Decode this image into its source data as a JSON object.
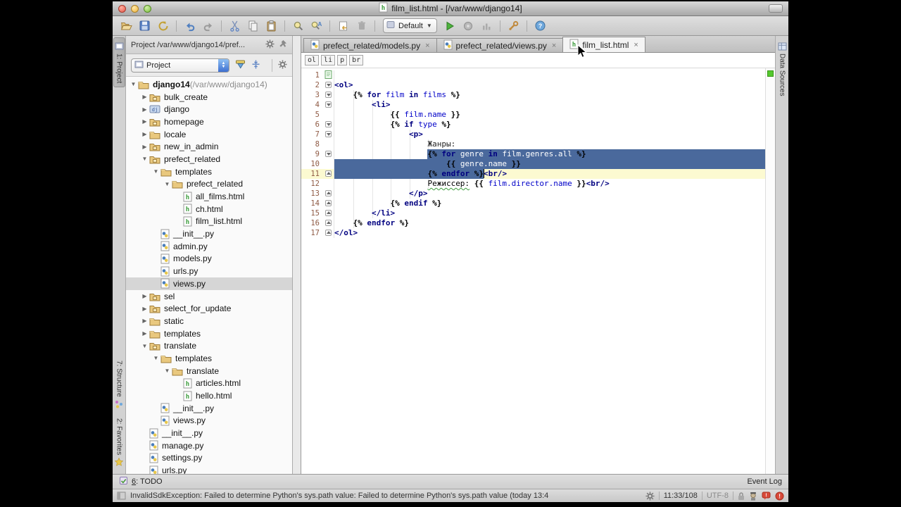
{
  "window": {
    "title": "film_list.html - [/var/www/django14]"
  },
  "toolbar": {
    "run_config": "Default",
    "buttons": [
      "open",
      "save",
      "sync",
      "|",
      "undo",
      "redo",
      "|",
      "cut",
      "copy",
      "paste",
      "|",
      "find",
      "replace",
      "|",
      "commit",
      "trash",
      "|",
      "combo",
      "run",
      "pkg",
      "cov",
      "|",
      "wrench",
      "|",
      "help"
    ]
  },
  "tabs": [
    {
      "label": "prefect_related/models.py",
      "icon": "py",
      "active": false
    },
    {
      "label": "prefect_related/views.py",
      "icon": "py",
      "active": false
    },
    {
      "label": "film_list.html",
      "icon": "html",
      "active": true
    }
  ],
  "tab_close_glyph": "×",
  "breadcrumbs": [
    "ol",
    "li",
    "p",
    "br"
  ],
  "left_stripe": {
    "project": "1: Project",
    "structure": "7: Structure",
    "favorites": "2: Favorites"
  },
  "right_stripe": {
    "data_sources": "Data Sources"
  },
  "project_panel": {
    "header": "Project /var/www/django14/pref...",
    "view_selector": "Project",
    "tree": [
      {
        "lv": 0,
        "icon": "folder",
        "arrow": "open",
        "label": "django14",
        "suffix": " (/var/www/django14)",
        "bold": true
      },
      {
        "lv": 1,
        "icon": "package",
        "arrow": "closed",
        "label": "bulk_create"
      },
      {
        "lv": 1,
        "icon": "django",
        "arrow": "closed",
        "label": "django"
      },
      {
        "lv": 1,
        "icon": "package",
        "arrow": "closed",
        "label": "homepage"
      },
      {
        "lv": 1,
        "icon": "folder",
        "arrow": "closed",
        "label": "locale"
      },
      {
        "lv": 1,
        "icon": "package",
        "arrow": "closed",
        "label": "new_in_admin"
      },
      {
        "lv": 1,
        "icon": "package",
        "arrow": "open",
        "label": "prefect_related"
      },
      {
        "lv": 2,
        "icon": "folder",
        "arrow": "open",
        "label": "templates"
      },
      {
        "lv": 3,
        "icon": "folder",
        "arrow": "open",
        "label": "prefect_related"
      },
      {
        "lv": 4,
        "icon": "html",
        "arrow": "",
        "label": "all_films.html"
      },
      {
        "lv": 4,
        "icon": "html",
        "arrow": "",
        "label": "ch.html"
      },
      {
        "lv": 4,
        "icon": "html",
        "arrow": "",
        "label": "film_list.html"
      },
      {
        "lv": 2,
        "icon": "py",
        "arrow": "",
        "label": "__init__.py"
      },
      {
        "lv": 2,
        "icon": "py",
        "arrow": "",
        "label": "admin.py"
      },
      {
        "lv": 2,
        "icon": "py",
        "arrow": "",
        "label": "models.py"
      },
      {
        "lv": 2,
        "icon": "py",
        "arrow": "",
        "label": "urls.py"
      },
      {
        "lv": 2,
        "icon": "py",
        "arrow": "",
        "label": "views.py",
        "sel": true
      },
      {
        "lv": 1,
        "icon": "package",
        "arrow": "closed",
        "label": "sel"
      },
      {
        "lv": 1,
        "icon": "package",
        "arrow": "closed",
        "label": "select_for_update"
      },
      {
        "lv": 1,
        "icon": "folder",
        "arrow": "closed",
        "label": "static"
      },
      {
        "lv": 1,
        "icon": "folder",
        "arrow": "closed",
        "label": "templates"
      },
      {
        "lv": 1,
        "icon": "package",
        "arrow": "open",
        "label": "translate"
      },
      {
        "lv": 2,
        "icon": "folder",
        "arrow": "open",
        "label": "templates"
      },
      {
        "lv": 3,
        "icon": "folder",
        "arrow": "open",
        "label": "translate"
      },
      {
        "lv": 4,
        "icon": "html",
        "arrow": "",
        "label": "articles.html"
      },
      {
        "lv": 4,
        "icon": "html",
        "arrow": "",
        "label": "hello.html"
      },
      {
        "lv": 2,
        "icon": "py",
        "arrow": "",
        "label": "__init__.py"
      },
      {
        "lv": 2,
        "icon": "py",
        "arrow": "",
        "label": "views.py"
      },
      {
        "lv": 1,
        "icon": "py",
        "arrow": "",
        "label": "__init__.py"
      },
      {
        "lv": 1,
        "icon": "py",
        "arrow": "",
        "label": "manage.py"
      },
      {
        "lv": 1,
        "icon": "py",
        "arrow": "",
        "label": "settings.py"
      },
      {
        "lv": 1,
        "icon": "py",
        "arrow": "",
        "label": "urls.py"
      }
    ]
  },
  "editor": {
    "lines": [
      {
        "n": 1,
        "icon": "file",
        "segs": []
      },
      {
        "n": 2,
        "fold": "open",
        "segs": [
          [
            "t",
            "<ol>"
          ]
        ]
      },
      {
        "n": 3,
        "fold": "open",
        "segs": [
          [
            "x",
            "    "
          ],
          [
            "b",
            "{%"
          ],
          [
            "x",
            " "
          ],
          [
            "k",
            "for"
          ],
          [
            "x",
            " "
          ],
          [
            "v",
            "film"
          ],
          [
            "x",
            " "
          ],
          [
            "k",
            "in"
          ],
          [
            "x",
            " "
          ],
          [
            "v",
            "films"
          ],
          [
            "x",
            " "
          ],
          [
            "b",
            "%}"
          ]
        ]
      },
      {
        "n": 4,
        "fold": "open",
        "segs": [
          [
            "x",
            "        "
          ],
          [
            "t",
            "<li>"
          ]
        ]
      },
      {
        "n": 5,
        "segs": [
          [
            "x",
            "            "
          ],
          [
            "b",
            "{{"
          ],
          [
            "x",
            " "
          ],
          [
            "v",
            "film.name"
          ],
          [
            "x",
            " "
          ],
          [
            "b",
            "}}"
          ]
        ]
      },
      {
        "n": 6,
        "fold": "open",
        "segs": [
          [
            "x",
            "            "
          ],
          [
            "b",
            "{%"
          ],
          [
            "x",
            " "
          ],
          [
            "k",
            "if"
          ],
          [
            "x",
            " "
          ],
          [
            "v",
            "type"
          ],
          [
            "x",
            " "
          ],
          [
            "b",
            "%}"
          ]
        ]
      },
      {
        "n": 7,
        "fold": "open",
        "segs": [
          [
            "x",
            "                "
          ],
          [
            "t",
            "<p>"
          ]
        ]
      },
      {
        "n": 8,
        "segs": [
          [
            "x",
            "                    "
          ],
          [
            "x",
            "Жанры:"
          ]
        ]
      },
      {
        "n": 9,
        "fold": "open",
        "onsel": true,
        "sel": {
          "start": 20
        },
        "segs": [
          [
            "x",
            "                    "
          ],
          [
            "b",
            "{%"
          ],
          [
            "x",
            " "
          ],
          [
            "k",
            "for"
          ],
          [
            "x",
            " "
          ],
          [
            "v",
            "genre"
          ],
          [
            "x",
            " "
          ],
          [
            "k",
            "in"
          ],
          [
            "x",
            " "
          ],
          [
            "v",
            "film.genres.all"
          ],
          [
            "x",
            " "
          ],
          [
            "b",
            "%}"
          ]
        ]
      },
      {
        "n": 10,
        "onsel": true,
        "sel": {
          "start": 0
        },
        "segs": [
          [
            "x",
            "                        "
          ],
          [
            "b",
            "{{"
          ],
          [
            "x",
            " "
          ],
          [
            "v",
            "genre.name"
          ],
          [
            "x",
            " "
          ],
          [
            "b",
            "}}"
          ]
        ]
      },
      {
        "n": 11,
        "fold": "close",
        "cur": true,
        "caret": 32,
        "sel": {
          "start": 0,
          "width": 32
        },
        "segs": [
          [
            "x",
            "                    "
          ],
          [
            "b",
            "{%"
          ],
          [
            "x",
            " "
          ],
          [
            "k",
            "endfor"
          ],
          [
            "x",
            " "
          ],
          [
            "b",
            "%}"
          ],
          [
            "t",
            "<br/>"
          ]
        ]
      },
      {
        "n": 12,
        "segs": [
          [
            "x",
            "                    "
          ],
          [
            "m",
            "Режиссер:"
          ],
          [
            "x",
            " "
          ],
          [
            "b",
            "{{"
          ],
          [
            "x",
            " "
          ],
          [
            "v",
            "film.director.name"
          ],
          [
            "x",
            " "
          ],
          [
            "b",
            "}}"
          ],
          [
            "t",
            "<br/>"
          ]
        ]
      },
      {
        "n": 13,
        "fold": "close",
        "segs": [
          [
            "x",
            "                "
          ],
          [
            "t",
            "</p>"
          ]
        ]
      },
      {
        "n": 14,
        "fold": "close",
        "segs": [
          [
            "x",
            "            "
          ],
          [
            "b",
            "{%"
          ],
          [
            "x",
            " "
          ],
          [
            "k",
            "endif"
          ],
          [
            "x",
            " "
          ],
          [
            "b",
            "%}"
          ]
        ]
      },
      {
        "n": 15,
        "fold": "close",
        "segs": [
          [
            "x",
            "        "
          ],
          [
            "t",
            "</li>"
          ]
        ]
      },
      {
        "n": 16,
        "fold": "close",
        "segs": [
          [
            "x",
            "    "
          ],
          [
            "b",
            "{%"
          ],
          [
            "x",
            " "
          ],
          [
            "k",
            "endfor"
          ],
          [
            "x",
            " "
          ],
          [
            "b",
            "%}"
          ]
        ]
      },
      {
        "n": 17,
        "fold": "close",
        "segs": [
          [
            "t",
            "</ol>"
          ]
        ]
      }
    ]
  },
  "todo_bar": {
    "num": "6",
    "text": ": TODO",
    "event_log": "Event Log"
  },
  "status_bar": {
    "message": "InvalidSdkException: Failed to determine Python's sys.path value: Failed to determine Python's sys.path value (today 13:4",
    "position": "11:33/108",
    "encoding": "UTF-8"
  }
}
